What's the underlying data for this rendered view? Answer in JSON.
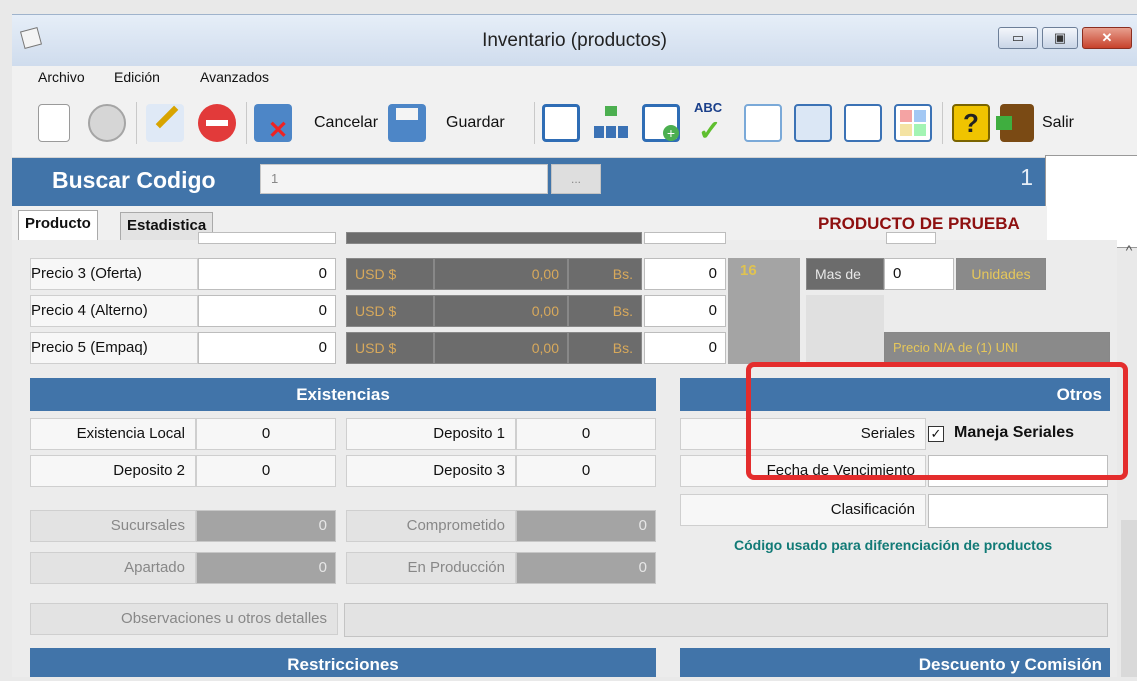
{
  "window": {
    "title": "Inventario (productos)",
    "buttons": [
      "▭",
      "▣",
      "✕"
    ]
  },
  "menu": [
    "Archivo",
    "Edición",
    "Avanzados"
  ],
  "toolbar": {
    "cancel_label": "Cancelar",
    "save_label": "Guardar",
    "exit_label": "Salir"
  },
  "search": {
    "label": "Buscar Codigo",
    "value": "1",
    "button": "...",
    "count": "1"
  },
  "tabs": [
    "Producto",
    "Estadistica"
  ],
  "product_name": "PRODUCTO DE PRUEBA",
  "prices": [
    {
      "label": "Precio 3 (Oferta)",
      "value": "0",
      "currency": "USD $",
      "usd": "0,00",
      "bs_label": "Bs.",
      "bs": "0"
    },
    {
      "label": "Precio 4 (Alterno)",
      "value": "0",
      "currency": "USD $",
      "usd": "0,00",
      "bs_label": "Bs.",
      "bs": "0"
    },
    {
      "label": "Precio 5 (Empaq)",
      "value": "0",
      "currency": "USD $",
      "usd": "0,00",
      "bs_label": "Bs.",
      "bs": "0"
    }
  ],
  "qty_badge": "16",
  "mas_de": {
    "label": "Mas de",
    "value": "0",
    "unit": "Unidades"
  },
  "precio_na": "Precio N/A de (1) UNI",
  "existencias": {
    "title": "Existencias",
    "rows": [
      {
        "label1": "Existencia Local",
        "value1": "0",
        "label2": "Deposito 1",
        "value2": "0"
      },
      {
        "label1": "Deposito 2",
        "value1": "0",
        "label2": "Deposito 3",
        "value2": "0"
      },
      {
        "label1": "Sucursales",
        "value1": "0",
        "label2": "Comprometido",
        "value2": "0"
      },
      {
        "label1": "Apartado",
        "value1": "0",
        "label2": "En Producción",
        "value2": "0"
      }
    ]
  },
  "otros": {
    "title": "Otros",
    "seriales_label": "Seriales",
    "seriales_check": "✓",
    "seriales_option": "Maneja Seriales",
    "vencimiento_label": "Fecha de Vencimiento",
    "clasificacion_label": "Clasificación",
    "note": "Código usado para diferenciación de productos"
  },
  "observaciones_label": "Observaciones u otros detalles",
  "restricciones_title": "Restricciones",
  "descuento_title": "Descuento y Comisión"
}
